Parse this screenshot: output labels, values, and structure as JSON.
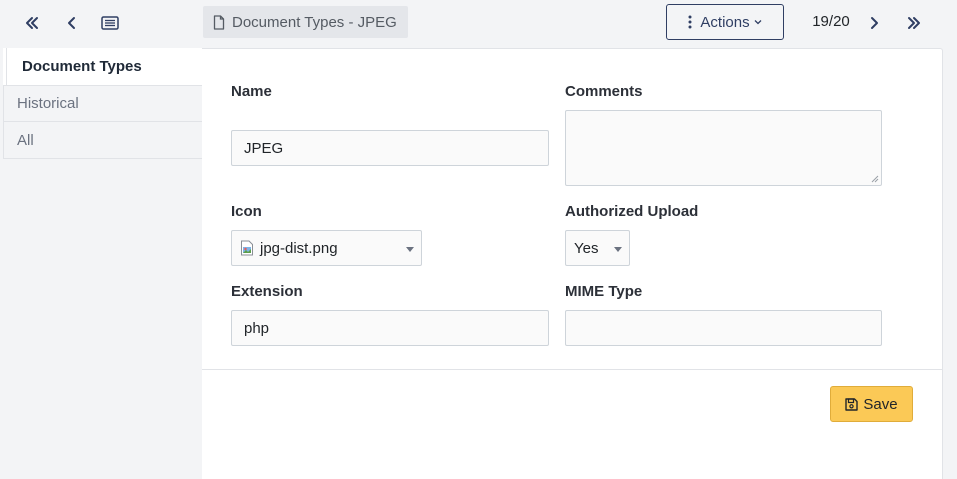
{
  "toolbar": {
    "first_icon": "double-chevron-left-icon",
    "prev_icon": "chevron-left-icon",
    "list_icon": "list-icon",
    "breadcrumb": "Document Types - JPEG",
    "actions_label": "Actions",
    "pager": "19/20",
    "next_icon": "chevron-right-icon",
    "last_icon": "double-chevron-right-icon"
  },
  "sidebar": {
    "items": [
      {
        "label": "Document Types",
        "active": true
      },
      {
        "label": "Historical",
        "active": false
      },
      {
        "label": "All",
        "active": false
      }
    ]
  },
  "form": {
    "name_label": "Name",
    "name_value": "JPEG",
    "comments_label": "Comments",
    "comments_value": "",
    "icon_label": "Icon",
    "icon_value": "jpg-dist.png",
    "authorized_label": "Authorized Upload",
    "authorized_value": "Yes",
    "extension_label": "Extension",
    "extension_value": "php",
    "mime_label": "MIME Type",
    "mime_value": ""
  },
  "footer": {
    "save_label": "Save"
  },
  "colors": {
    "accent": "#2f3e63",
    "save": "#fbc956",
    "background": "#f3f4f6"
  }
}
